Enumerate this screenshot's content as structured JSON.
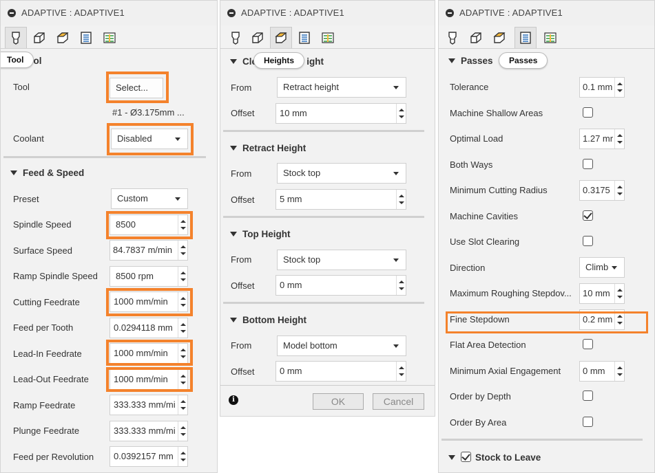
{
  "panel1": {
    "title": "ADAPTIVE : ADAPTIVE1",
    "tooltip": "Tool",
    "section_tool": "Tool",
    "tool_label": "Tool",
    "select_button": "Select...",
    "tool_desc": "#1 - Ø3.175mm ...",
    "coolant_label": "Coolant",
    "coolant_value": "Disabled",
    "section_feed": "Feed & Speed",
    "rows": [
      {
        "label": "Preset",
        "value": "Custom"
      },
      {
        "label": "Spindle Speed",
        "value": "8500"
      },
      {
        "label": "Surface Speed",
        "value": "84.7837 m/min"
      },
      {
        "label": "Ramp Spindle Speed",
        "value": "8500 rpm"
      },
      {
        "label": "Cutting Feedrate",
        "value": "1000 mm/min"
      },
      {
        "label": "Feed per Tooth",
        "value": "0.0294118 mm"
      },
      {
        "label": "Lead-In Feedrate",
        "value": "1000 mm/min"
      },
      {
        "label": "Lead-Out Feedrate",
        "value": "1000 mm/min"
      },
      {
        "label": "Ramp Feedrate",
        "value": "333.333 mm/mi"
      },
      {
        "label": "Plunge Feedrate",
        "value": "333.333 mm/mi"
      },
      {
        "label": "Feed per Revolution",
        "value": "0.0392157 mm"
      }
    ]
  },
  "panel2": {
    "title": "ADAPTIVE : ADAPTIVE1",
    "tooltip": "Heights",
    "sections": [
      {
        "title": "Clearance Height",
        "from_label": "From",
        "from": "Retract height",
        "offset_label": "Offset",
        "offset": "10 mm"
      },
      {
        "title": "Retract Height",
        "from_label": "From",
        "from": "Stock top",
        "offset_label": "Offset",
        "offset": "5 mm"
      },
      {
        "title": "Top Height",
        "from_label": "From",
        "from": "Stock top",
        "offset_label": "Offset",
        "offset": "0 mm"
      },
      {
        "title": "Bottom Height",
        "from_label": "From",
        "from": "Model bottom",
        "offset_label": "Offset",
        "offset": "0 mm"
      }
    ],
    "ok": "OK",
    "cancel": "Cancel",
    "info": "i"
  },
  "panel3": {
    "title": "ADAPTIVE : ADAPTIVE1",
    "section": "Passes",
    "tooltip": "Passes",
    "rows": [
      {
        "label": "Tolerance",
        "value": "0.1 mm"
      },
      {
        "label": "Machine Shallow Areas",
        "checked": false
      },
      {
        "label": "Optimal Load",
        "value": "1.27 mr"
      },
      {
        "label": "Both Ways",
        "checked": false
      },
      {
        "label": "Minimum Cutting Radius",
        "value": "0.3175"
      },
      {
        "label": "Machine Cavities",
        "checked": true
      },
      {
        "label": "Use Slot Clearing",
        "checked": false
      },
      {
        "label": "Direction",
        "value": "Climb"
      },
      {
        "label": "Maximum Roughing Stepdov...",
        "value": "10 mm"
      },
      {
        "label": "Fine Stepdown",
        "value": "0.2 mm"
      },
      {
        "label": "Flat Area Detection",
        "checked": false
      },
      {
        "label": "Minimum Axial Engagement",
        "value": "0 mm"
      },
      {
        "label": "Order by Depth",
        "checked": false
      },
      {
        "label": "Order By Area",
        "checked": false
      }
    ],
    "stock_section": "Stock to Leave"
  },
  "colors": {
    "highlight": "#f4822c",
    "panel_bg": "#f2f2f2"
  },
  "icons": [
    "minus-circle-icon",
    "tool-tab-icon",
    "geometry-tab-icon",
    "heights-tab-icon",
    "passes-tab-icon",
    "linking-tab-icon",
    "info-icon"
  ]
}
